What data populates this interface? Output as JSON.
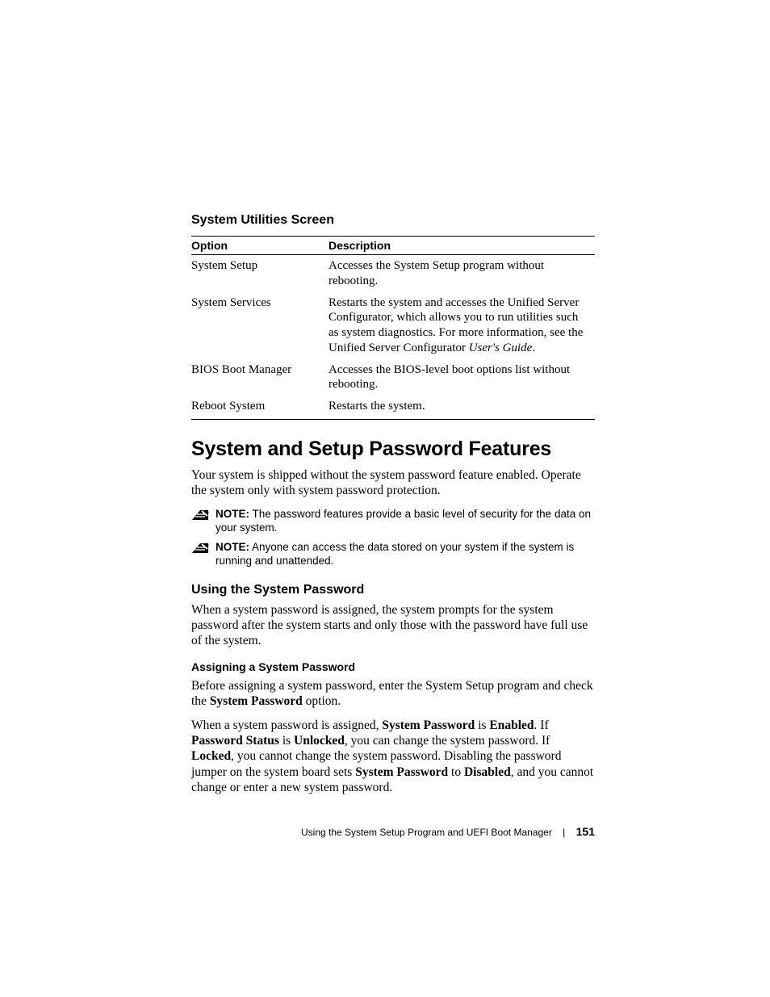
{
  "section_title": "System Utilities Screen",
  "table": {
    "headers": {
      "opt": "Option",
      "desc": "Description"
    },
    "rows": [
      {
        "opt": "System Setup",
        "desc": "Accesses the System Setup program without rebooting."
      },
      {
        "opt": "System Services",
        "desc_pre": "Restarts the system and accesses the Unified Server Configurator, which allows you to run utilities such as system diagnostics. For more information, see the Unified Server Configurator ",
        "desc_em": "User's Guide",
        "desc_post": "."
      },
      {
        "opt": "BIOS Boot Manager",
        "desc": "Accesses the BIOS-level boot options list without rebooting."
      },
      {
        "opt": "Reboot System",
        "desc": "Restarts the system."
      }
    ]
  },
  "h1": "System and Setup Password Features",
  "intro": "Your system is shipped without the system password feature enabled. Operate the system only with system password protection.",
  "notes": [
    {
      "label": "NOTE:",
      "text": " The password features provide a basic level of security for the data on your system."
    },
    {
      "label": "NOTE:",
      "text": " Anyone can access the data stored on your system if the system is running and unattended."
    }
  ],
  "sub1": {
    "title": "Using the System Password",
    "para": "When a system password is assigned, the system prompts for the system password after the system starts and only those with the password have full use of the system."
  },
  "sub2": {
    "title": "Assigning a System Password",
    "p1_pre": "Before assigning a system password, enter the System Setup program and check the ",
    "p1_b1": "System Password",
    "p1_post": " option.",
    "p2": {
      "t0": "When a system password is assigned, ",
      "b1": "System Password",
      "t1": " is ",
      "b2": "Enabled",
      "t2": ". If ",
      "b3": "Password Status",
      "t3": " is ",
      "b4": "Unlocked",
      "t4": ", you can change the system password. If ",
      "b5": "Locked",
      "t5": ", you cannot change the system password. Disabling the password jumper on the system board sets ",
      "b6": "System Password",
      "t6": " to ",
      "b7": "Disabled",
      "t7": ", and you cannot change or enter a new system password."
    }
  },
  "footer": {
    "text": "Using the System Setup Program and UEFI Boot Manager",
    "page": "151"
  }
}
